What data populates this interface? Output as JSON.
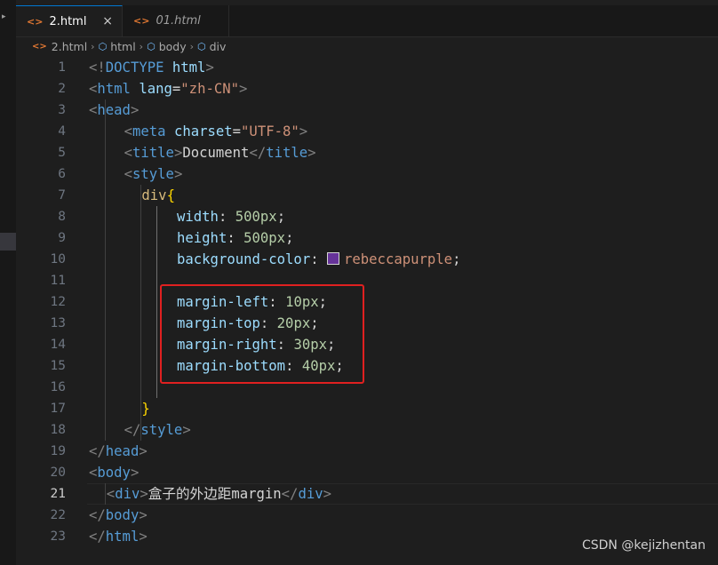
{
  "tabs": [
    {
      "label": "2.html",
      "active": true,
      "close": "×"
    },
    {
      "label": "01.html",
      "active": false
    }
  ],
  "tab_icon_glyph": "<>",
  "breadcrumb": [
    "2.html",
    "html",
    "body",
    "div"
  ],
  "cursor_line": 21,
  "colors": {
    "tag": "#569cd6",
    "attribute": "#9cdcfe",
    "string": "#ce9178",
    "selector": "#d7ba7d",
    "number": "#b5cea8",
    "swatch": "#663399",
    "highlight_box": "#e02020"
  },
  "lines": [
    {
      "n": "1",
      "indent": 0,
      "tokens": [
        [
          "punc",
          "<!"
        ],
        [
          "tag",
          "DOCTYPE"
        ],
        [
          "text",
          " "
        ],
        [
          "attr",
          "html"
        ],
        [
          "punc",
          ">"
        ]
      ]
    },
    {
      "n": "2",
      "indent": 0,
      "tokens": [
        [
          "punc",
          "<"
        ],
        [
          "tag",
          "html"
        ],
        [
          "text",
          " "
        ],
        [
          "attr",
          "lang"
        ],
        [
          "text",
          "="
        ],
        [
          "str",
          "\"zh-CN\""
        ],
        [
          "punc",
          ">"
        ]
      ]
    },
    {
      "n": "3",
      "indent": 0,
      "tokens": [
        [
          "punc",
          "<"
        ],
        [
          "tag",
          "head"
        ],
        [
          "punc",
          ">"
        ]
      ]
    },
    {
      "n": "4",
      "indent": 4,
      "tokens": [
        [
          "punc",
          "<"
        ],
        [
          "tag",
          "meta"
        ],
        [
          "text",
          " "
        ],
        [
          "attr",
          "charset"
        ],
        [
          "text",
          "="
        ],
        [
          "str",
          "\"UTF-8\""
        ],
        [
          "punc",
          ">"
        ]
      ]
    },
    {
      "n": "5",
      "indent": 4,
      "tokens": [
        [
          "punc",
          "<"
        ],
        [
          "tag",
          "title"
        ],
        [
          "punc",
          ">"
        ],
        [
          "text",
          "Document"
        ],
        [
          "punc",
          "</"
        ],
        [
          "tag",
          "title"
        ],
        [
          "punc",
          ">"
        ]
      ]
    },
    {
      "n": "6",
      "indent": 4,
      "tokens": [
        [
          "punc",
          "<"
        ],
        [
          "tag",
          "style"
        ],
        [
          "punc",
          ">"
        ]
      ]
    },
    {
      "n": "7",
      "indent": 6,
      "tokens": [
        [
          "sel",
          "div"
        ],
        [
          "brace",
          "{"
        ]
      ]
    },
    {
      "n": "8",
      "indent": 10,
      "tokens": [
        [
          "prop",
          "width"
        ],
        [
          "text",
          ": "
        ],
        [
          "num",
          "500px"
        ],
        [
          "text",
          ";"
        ]
      ]
    },
    {
      "n": "9",
      "indent": 10,
      "tokens": [
        [
          "prop",
          "height"
        ],
        [
          "text",
          ": "
        ],
        [
          "num",
          "500px"
        ],
        [
          "text",
          ";"
        ]
      ]
    },
    {
      "n": "10",
      "indent": 10,
      "tokens": [
        [
          "prop",
          "background-color"
        ],
        [
          "text",
          ": "
        ],
        [
          "swatch",
          ""
        ],
        [
          "val",
          "rebeccapurple"
        ],
        [
          "text",
          ";"
        ]
      ]
    },
    {
      "n": "11",
      "indent": 0,
      "tokens": []
    },
    {
      "n": "12",
      "indent": 10,
      "tokens": [
        [
          "prop",
          "margin-left"
        ],
        [
          "text",
          ": "
        ],
        [
          "num",
          "10px"
        ],
        [
          "text",
          ";"
        ]
      ]
    },
    {
      "n": "13",
      "indent": 10,
      "tokens": [
        [
          "prop",
          "margin-top"
        ],
        [
          "text",
          ": "
        ],
        [
          "num",
          "20px"
        ],
        [
          "text",
          ";"
        ]
      ]
    },
    {
      "n": "14",
      "indent": 10,
      "tokens": [
        [
          "prop",
          "margin-right"
        ],
        [
          "text",
          ": "
        ],
        [
          "num",
          "30px"
        ],
        [
          "text",
          ";"
        ]
      ]
    },
    {
      "n": "15",
      "indent": 10,
      "tokens": [
        [
          "prop",
          "margin-bottom"
        ],
        [
          "text",
          ": "
        ],
        [
          "num",
          "40px"
        ],
        [
          "text",
          ";"
        ]
      ]
    },
    {
      "n": "16",
      "indent": 0,
      "tokens": []
    },
    {
      "n": "17",
      "indent": 6,
      "tokens": [
        [
          "brace",
          "}"
        ]
      ]
    },
    {
      "n": "18",
      "indent": 4,
      "tokens": [
        [
          "punc",
          "</"
        ],
        [
          "tag",
          "style"
        ],
        [
          "punc",
          ">"
        ]
      ]
    },
    {
      "n": "19",
      "indent": 0,
      "tokens": [
        [
          "punc",
          "</"
        ],
        [
          "tag",
          "head"
        ],
        [
          "punc",
          ">"
        ]
      ]
    },
    {
      "n": "20",
      "indent": 0,
      "tokens": [
        [
          "punc",
          "<"
        ],
        [
          "tag",
          "body"
        ],
        [
          "punc",
          ">"
        ]
      ]
    },
    {
      "n": "21",
      "indent": 2,
      "tokens": [
        [
          "punc",
          "<"
        ],
        [
          "tag",
          "div"
        ],
        [
          "punc",
          ">"
        ],
        [
          "text",
          "盒子的外边距margin"
        ],
        [
          "punc",
          "</"
        ],
        [
          "tag",
          "div"
        ],
        [
          "punc",
          ">"
        ]
      ]
    },
    {
      "n": "22",
      "indent": 0,
      "tokens": [
        [
          "punc",
          "</"
        ],
        [
          "tag",
          "body"
        ],
        [
          "punc",
          ">"
        ]
      ]
    },
    {
      "n": "23",
      "indent": 0,
      "tokens": [
        [
          "punc",
          "</"
        ],
        [
          "tag",
          "html"
        ],
        [
          "punc",
          ">"
        ]
      ]
    }
  ],
  "watermark": "CSDN @kejizhentan"
}
